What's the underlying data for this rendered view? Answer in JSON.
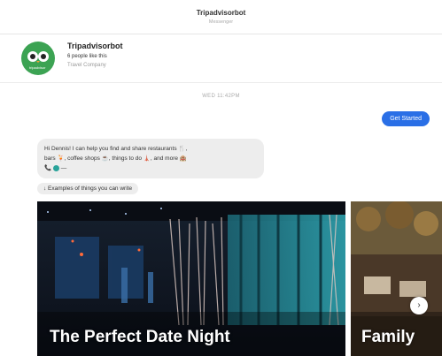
{
  "header": {
    "title": "Tripadvisorbot",
    "subtitle": "Messenger"
  },
  "profile": {
    "name": "Tripadvisorbot",
    "likes": "6 people like this",
    "category": "Travel Company",
    "avatar_text": "tripadvisor"
  },
  "conversation": {
    "timestamp": "WED 11:42PM",
    "sent_message": "Get Started",
    "bot_message_line1": "Hi Dennis! I can help you find and share restaurants 🍴,",
    "bot_message_line2": "bars 🍹, coffee shops ☕, things to do 🗼, and more 🏨",
    "bot_message_line3": "📞",
    "bot_message_line3_tail": "—",
    "examples_label": "↓ Examples of things you can write"
  },
  "carousel": {
    "cards": [
      {
        "caption": "The Perfect Date Night"
      },
      {
        "caption": "Family"
      }
    ],
    "next_arrow": "›"
  },
  "colors": {
    "accent_blue": "#2a6fe6",
    "brand_green": "#3ca353",
    "bubble_gray": "#ededed"
  }
}
